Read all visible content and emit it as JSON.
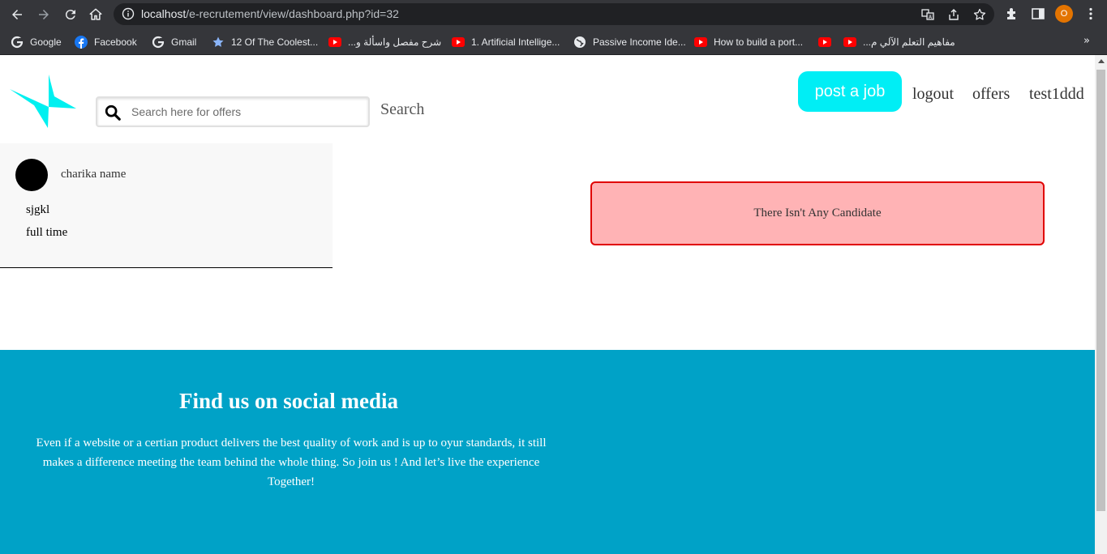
{
  "browser": {
    "url_host": "localhost",
    "url_path": "/e-recrutement/view/dashboard.php?id=32",
    "profile_initial": "O",
    "bookmarks": [
      {
        "label": "Google",
        "icon": "google-icon"
      },
      {
        "label": "Facebook",
        "icon": "facebook-icon"
      },
      {
        "label": "Gmail",
        "icon": "google-icon"
      },
      {
        "label": "12 Of The Coolest...",
        "icon": "star-icon"
      },
      {
        "label": "شرح مفصل واسألة و...",
        "icon": "youtube-icon"
      },
      {
        "label": "1. Artificial Intellige...",
        "icon": "youtube-icon"
      },
      {
        "label": "Passive Income Ide...",
        "icon": "globe-icon"
      },
      {
        "label": "How to build a port...",
        "icon": "youtube-icon"
      },
      {
        "label": "",
        "icon": "youtube-icon"
      },
      {
        "label": "مفاهيم التعلم الآلي م...",
        "icon": "youtube-icon"
      }
    ],
    "more_label": "»"
  },
  "header": {
    "search_placeholder": "Search here for offers",
    "search_button": "Search",
    "post_job": "post a job",
    "nav": [
      "logout",
      "offers",
      "test1ddd"
    ]
  },
  "offer": {
    "company": "charika name",
    "title": "sjgkl",
    "type": "full time"
  },
  "alert": {
    "message": "There Isn't Any Candidate"
  },
  "footer": {
    "title": "Find us on social media",
    "text": "Even if a website or a certian product delivers the best quality of work and is up to oyur standards, it still makes a difference meeting the team behind the whole thing. So join us ! And let’s live the experience Together!"
  },
  "colors": {
    "accent": "#00eef5",
    "footer": "#00a2c7",
    "alert_bg": "#ffb3b5",
    "alert_border": "#e00000",
    "chrome": "#35363a"
  }
}
